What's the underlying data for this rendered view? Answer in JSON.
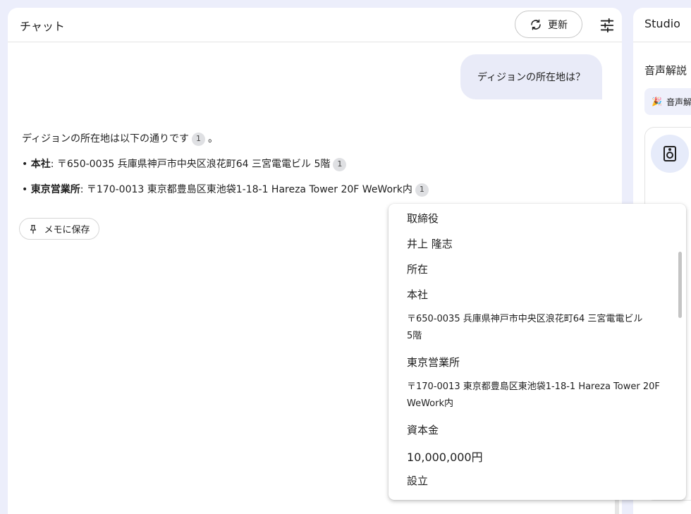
{
  "chat": {
    "title": "チャット",
    "refresh_label": "更新",
    "user_message": "ディジョンの所在地は？",
    "answer": {
      "intro": "ディジョンの所在地は以下の通りです",
      "intro_end": "。",
      "hq_label": "本社",
      "hq_text": ": 〒650-0035 兵庫県神戸市中央区浪花町64 三宮電電ビル 5階",
      "tokyo_label": "東京営業所",
      "tokyo_text": ": 〒170-0013 東京都豊島区東池袋1-18-1 Hareza Tower 20F WeWork内",
      "bullet": "•",
      "citation": "1"
    },
    "save_label": "メモに保存"
  },
  "studio": {
    "title": "Studio",
    "audio_title": "音声解説",
    "audio_chip": "音声解"
  },
  "dropdown": {
    "items": [
      "取締役",
      "井上 隆志",
      "所在",
      "本社",
      "〒650-0035 兵庫県神戸市中央区浪花町64 三宮電電ビル",
      "5階",
      "東京営業所",
      "〒170-0013 東京都豊島区東池袋1-18-1 Hareza Tower 20F",
      "WeWork内",
      "資本金",
      "10,000,000円",
      "設立"
    ]
  },
  "colors": {
    "background": "#eceefb",
    "user_bubble": "#e9ebf8",
    "citation_chip": "#dfe0e3"
  },
  "icons": [
    "refresh-icon",
    "tune-icon",
    "pin-icon",
    "party-icon",
    "speaker-icon"
  ]
}
